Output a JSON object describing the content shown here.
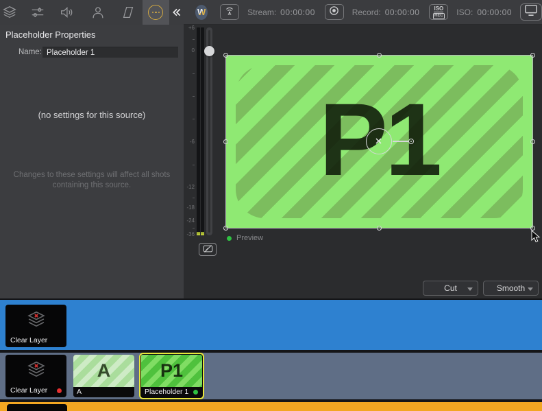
{
  "colors": {
    "accent-gold": "#d2a942",
    "selection-yellow": "#e9e73b",
    "live-red": "#e53030",
    "preview-green": "#2fc142",
    "row-blue": "#2e81d0",
    "row-slate": "#5f6e86",
    "row-orange": "#f2a622",
    "placeholder-green": "#8fe973",
    "placeholder-stripe": "#7cbd5e"
  },
  "icons": [
    "layers-icon",
    "audio-mixer-icon",
    "speaker-icon",
    "person-icon",
    "transform-icon",
    "more-ellipsis-icon",
    "collapse-panel-icon",
    "broadcast-icon",
    "record-icon",
    "iso-rec-icon",
    "monitor-icon",
    "audio-monitor-off-icon",
    "clear-layer-icon",
    "cursor-arrow"
  ],
  "toolbar": {
    "active_tab": "more"
  },
  "properties_panel": {
    "title": "Placeholder Properties",
    "name_label": "Name:",
    "name_value": "Placeholder 1",
    "empty_message": "(no settings for this source)",
    "footnote": "Changes to these settings will affect all shots containing this source."
  },
  "status_bar": {
    "logo_letter": "W",
    "stream_label": "Stream:",
    "stream_time": "00:00:00",
    "record_label": "Record:",
    "record_time": "00:00:00",
    "iso_button_line1": "ISO",
    "iso_button_line2": "REC",
    "iso_label": "ISO:",
    "iso_time": "00:00:00"
  },
  "preview": {
    "placeholder_text": "P1",
    "label": "Preview",
    "meter_labels": [
      "+6",
      "0",
      "-6",
      "-12",
      "-18",
      "-24",
      "-36"
    ]
  },
  "transition": {
    "cut_label": "Cut",
    "smooth_label": "Smooth"
  },
  "clips": {
    "row1": [
      {
        "label": "Clear Layer"
      }
    ],
    "row2": [
      {
        "label": "Clear Layer"
      },
      {
        "label": "A",
        "thumb_text": "A"
      },
      {
        "label": "Placeholder 1",
        "thumb_text": "P1"
      }
    ]
  }
}
